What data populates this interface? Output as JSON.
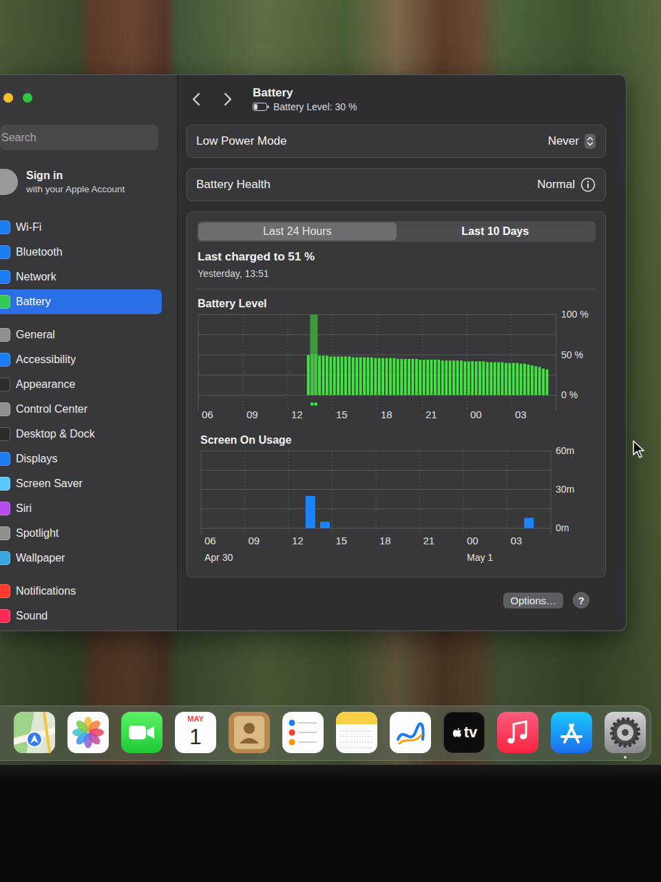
{
  "window": {
    "title": "Battery",
    "subtitle": "Battery Level: 30 %",
    "battery_level": 0.3
  },
  "sidebar": {
    "search": {
      "placeholder": "Search"
    },
    "account": {
      "title": "Sign in",
      "subtitle": "with your Apple Account"
    },
    "groups": [
      [
        {
          "label": "Wi-Fi",
          "selected": false,
          "color": "#1e7cf2"
        },
        {
          "label": "Bluetooth",
          "selected": false,
          "color": "#1e7cf2"
        },
        {
          "label": "Network",
          "selected": false,
          "color": "#1e7cf2"
        },
        {
          "label": "Battery",
          "selected": true,
          "color": "#34c759"
        }
      ],
      [
        {
          "label": "General",
          "selected": false,
          "color": "#8e8e93"
        },
        {
          "label": "Accessibility",
          "selected": false,
          "color": "#1e7cf2"
        },
        {
          "label": "Appearance",
          "selected": false,
          "color": "#2c2c2e"
        },
        {
          "label": "Control Center",
          "selected": false,
          "color": "#8e8e93"
        },
        {
          "label": "Desktop & Dock",
          "selected": false,
          "color": "#2c2c2e"
        },
        {
          "label": "Displays",
          "selected": false,
          "color": "#1e7cf2"
        },
        {
          "label": "Screen Saver",
          "selected": false,
          "color": "#5ac8fa"
        },
        {
          "label": "Siri",
          "selected": false,
          "color": "#b44cf0"
        },
        {
          "label": "Spotlight",
          "selected": false,
          "color": "#8e8e93"
        },
        {
          "label": "Wallpaper",
          "selected": false,
          "color": "#3aa8e0"
        }
      ],
      [
        {
          "label": "Notifications",
          "selected": false,
          "color": "#ff3b30"
        },
        {
          "label": "Sound",
          "selected": false,
          "color": "#ff2d55"
        }
      ]
    ]
  },
  "settings": [
    {
      "label": "Low Power Mode",
      "value": "Never",
      "kind": "popup"
    },
    {
      "label": "Battery Health",
      "value": "Normal",
      "kind": "info"
    }
  ],
  "tabs": [
    {
      "label": "Last 24 Hours",
      "selected": true
    },
    {
      "label": "Last 10 Days",
      "selected": false
    }
  ],
  "last_charged": {
    "title": "Last charged to 51 %",
    "time": "Yesterday, 13:51"
  },
  "battery_chart": {
    "title": "Battery Level",
    "y_ticks": [
      "100 %",
      "50 %",
      "0 %"
    ],
    "x_ticks": [
      "06",
      "09",
      "12",
      "15",
      "18",
      "21",
      "00",
      "03"
    ],
    "values": [
      null,
      null,
      null,
      null,
      null,
      null,
      null,
      null,
      null,
      null,
      null,
      null,
      null,
      null,
      null,
      null,
      null,
      null,
      null,
      null,
      null,
      null,
      null,
      null,
      null,
      null,
      null,
      null,
      null,
      50,
      51,
      51,
      49,
      49,
      49,
      48,
      48,
      48,
      48,
      48,
      48,
      47,
      47,
      47,
      47,
      47,
      47,
      46,
      46,
      46,
      46,
      46,
      46,
      45,
      45,
      45,
      45,
      45,
      45,
      44,
      44,
      44,
      44,
      44,
      44,
      43,
      43,
      43,
      43,
      43,
      43,
      42,
      42,
      42,
      42,
      42,
      42,
      41,
      41,
      41,
      41,
      41,
      40,
      40,
      40,
      40,
      39,
      39,
      38,
      37,
      36,
      35,
      33,
      32,
      null,
      null
    ],
    "charging_slots": [
      30,
      31
    ]
  },
  "usage_chart": {
    "title": "Screen On Usage",
    "y_ticks": [
      "60m",
      "30m",
      "0m"
    ],
    "max": 60,
    "x_ticks": [
      {
        "label": "06",
        "date": "Apr 30"
      },
      {
        "label": "09"
      },
      {
        "label": "12"
      },
      {
        "label": "15"
      },
      {
        "label": "18"
      },
      {
        "label": "21"
      },
      {
        "label": "00",
        "date": "May 1"
      },
      {
        "label": "03"
      }
    ],
    "values": [
      0,
      0,
      0,
      0,
      0,
      0,
      0,
      25,
      5,
      0,
      0,
      0,
      0,
      0,
      0,
      0,
      0,
      0,
      0,
      0,
      0,
      0,
      8,
      0
    ]
  },
  "buttons": {
    "options": "Options…",
    "help": "?"
  },
  "dock": [
    {
      "kind": "maps",
      "running": false
    },
    {
      "kind": "photos",
      "running": false
    },
    {
      "kind": "facetime",
      "running": false
    },
    {
      "kind": "calendar",
      "running": false,
      "month": "MAY",
      "day": "1"
    },
    {
      "kind": "contacts",
      "running": false
    },
    {
      "kind": "reminders",
      "running": false
    },
    {
      "kind": "notes",
      "running": false
    },
    {
      "kind": "freeform",
      "running": false
    },
    {
      "kind": "tv",
      "running": false,
      "label": "tv"
    },
    {
      "kind": "music",
      "running": false
    },
    {
      "kind": "appstore",
      "running": false
    },
    {
      "kind": "settings",
      "running": true
    }
  ]
}
